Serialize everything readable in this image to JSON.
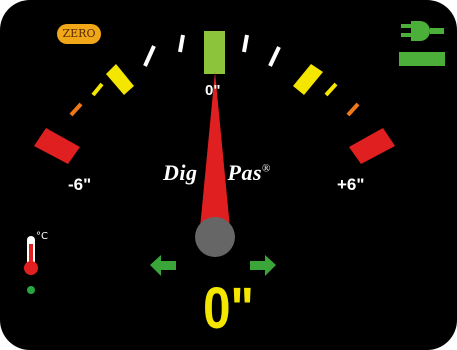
{
  "zero_button": {
    "label": "ZERO"
  },
  "scale": {
    "left_label": "-6\"",
    "right_label": "+6\"",
    "center_label": "0\""
  },
  "brand": {
    "part1": "Dig",
    "part2": "Pas",
    "mark": "®"
  },
  "reading": {
    "value": "0\"",
    "tilt_inches": 0
  },
  "temperature": {
    "unit": "°C",
    "icon": "thermometer-icon",
    "status_color": "#2aa640"
  },
  "power": {
    "icon": "plug-icon",
    "battery_color": "#4caf3a"
  },
  "direction": {
    "left_icon": "arrow-left-icon",
    "right_icon": "arrow-right-icon",
    "color": "#3aa63a"
  },
  "colors": {
    "center": "#8cc43c",
    "near": "#f5e600",
    "mid": "#f07818",
    "far": "#e02020",
    "needle": "#e02020",
    "pivot": "#666666"
  }
}
